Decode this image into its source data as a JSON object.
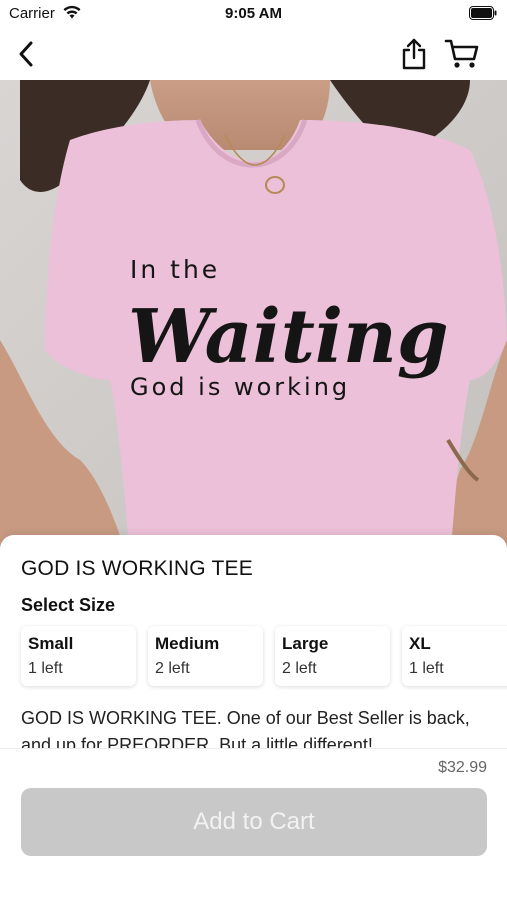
{
  "status_bar": {
    "carrier": "Carrier",
    "time": "9:05 AM"
  },
  "nav": {
    "back_icon": "chevron-left-icon",
    "share_icon": "share-icon",
    "cart_icon": "cart-icon"
  },
  "hero": {
    "shirt_color": "#ecc0d8",
    "print_line1": "In the",
    "print_line2": "Waiting",
    "print_line3": "God is working"
  },
  "product": {
    "title": "GOD IS WORKING TEE",
    "select_size_label": "Select Size",
    "sizes": [
      {
        "name": "Small",
        "stock": "1 left"
      },
      {
        "name": "Medium",
        "stock": "2 left"
      },
      {
        "name": "Large",
        "stock": "2 left"
      },
      {
        "name": "XL",
        "stock": "1 left"
      }
    ],
    "description": "GOD IS WORKING TEE. One of our Best Seller is back, and up for PREORDER. But a little different!"
  },
  "footer": {
    "price": "$32.99",
    "add_to_cart_label": "Add to Cart"
  }
}
